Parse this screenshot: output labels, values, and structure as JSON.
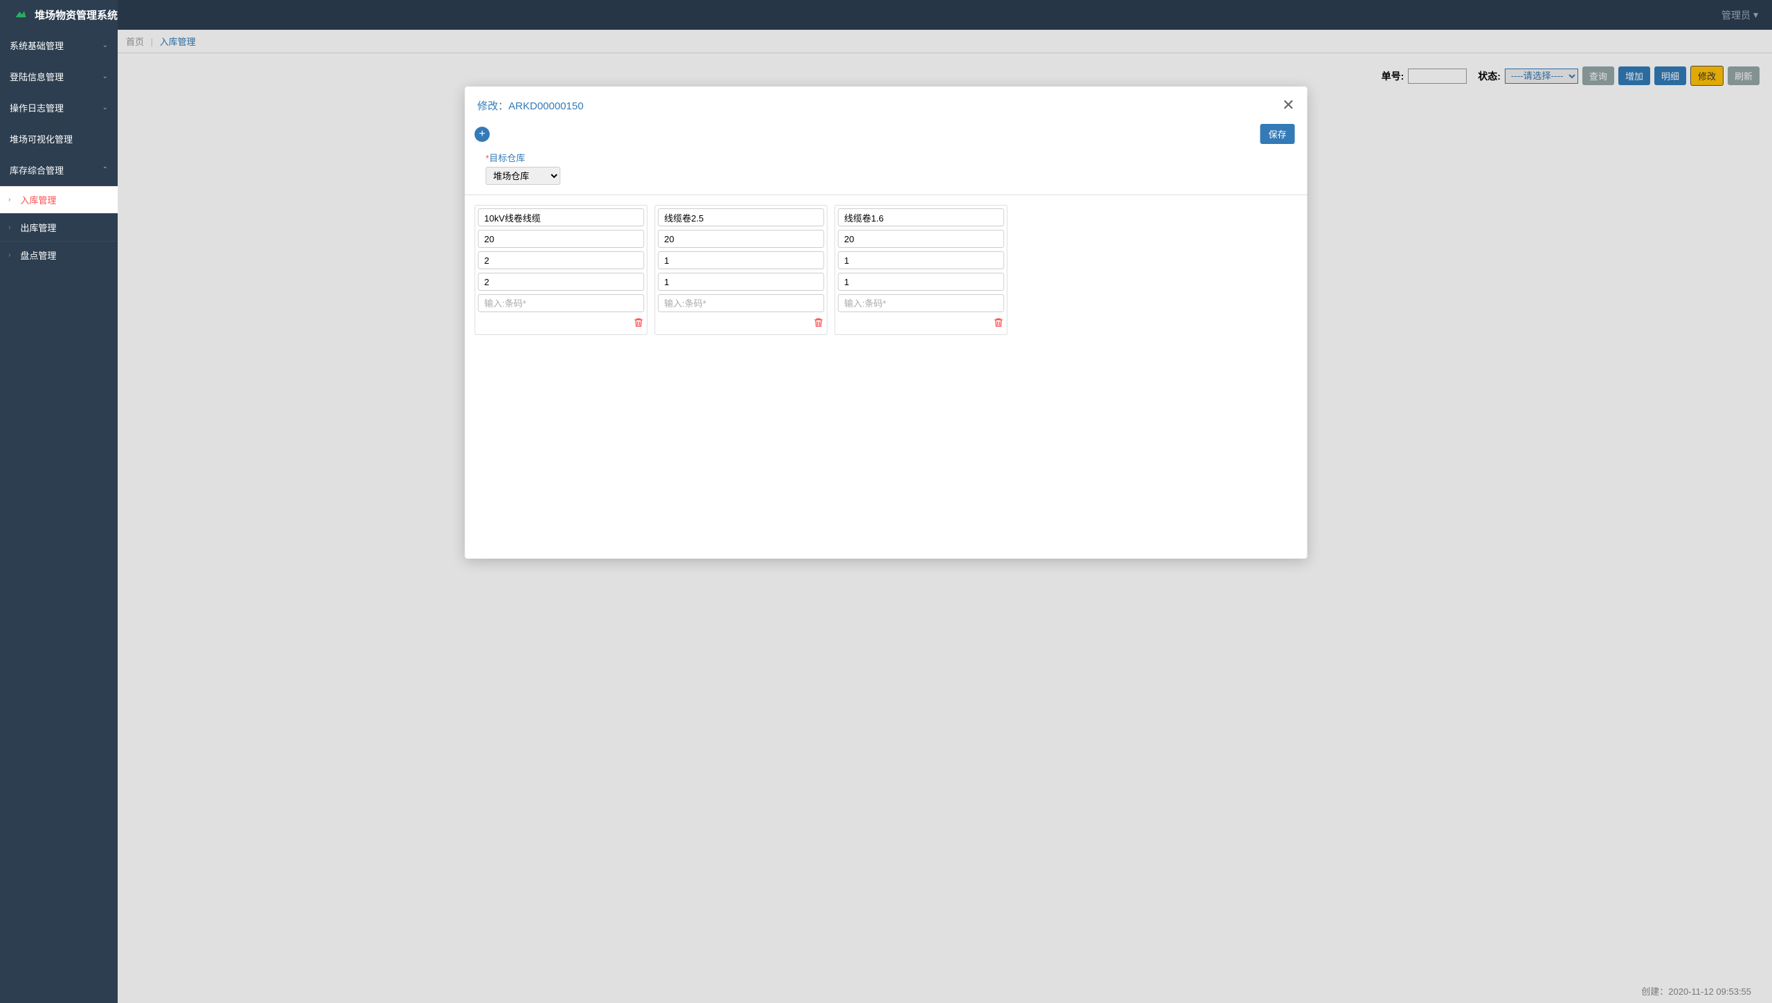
{
  "app": {
    "title": "堆场物资管理系统"
  },
  "header": {
    "user": "管理员"
  },
  "sidebar": {
    "items": [
      {
        "label": "系统基础管理",
        "expanded": false
      },
      {
        "label": "登陆信息管理",
        "expanded": false
      },
      {
        "label": "操作日志管理",
        "expanded": false
      },
      {
        "label": "堆场可视化管理",
        "expanded": false
      },
      {
        "label": "库存综合管理",
        "expanded": true
      }
    ],
    "submenu": [
      {
        "label": "入库管理",
        "active": true
      },
      {
        "label": "出库管理",
        "active": false
      },
      {
        "label": "盘点管理",
        "active": false
      }
    ]
  },
  "breadcrumb": {
    "home": "首页",
    "current": "入库管理"
  },
  "toolbar": {
    "order_label": "单号:",
    "status_label": "状态:",
    "status_placeholder": "----请选择----",
    "query": "查询",
    "add": "增加",
    "detail": "明细",
    "edit": "修改",
    "refresh": "刷新"
  },
  "modal": {
    "title_prefix": "修改：",
    "order_no": "ARKD00000150",
    "save": "保存",
    "target_label_star": "*",
    "target_label": "目标仓库",
    "warehouse_selected": "堆场仓库",
    "barcode_placeholder": "输入:条码*",
    "cards": [
      {
        "name": "10kV线卷线缆",
        "f2": "20",
        "f3": "2",
        "f4": "2"
      },
      {
        "name": "线缆卷2.5",
        "f2": "20",
        "f3": "1",
        "f4": "1"
      },
      {
        "name": "线缆卷1.6",
        "f2": "20",
        "f3": "1",
        "f4": "1"
      }
    ]
  },
  "footer": {
    "created_label": "创建：",
    "created_time": "2020-11-12 09:53:55"
  }
}
